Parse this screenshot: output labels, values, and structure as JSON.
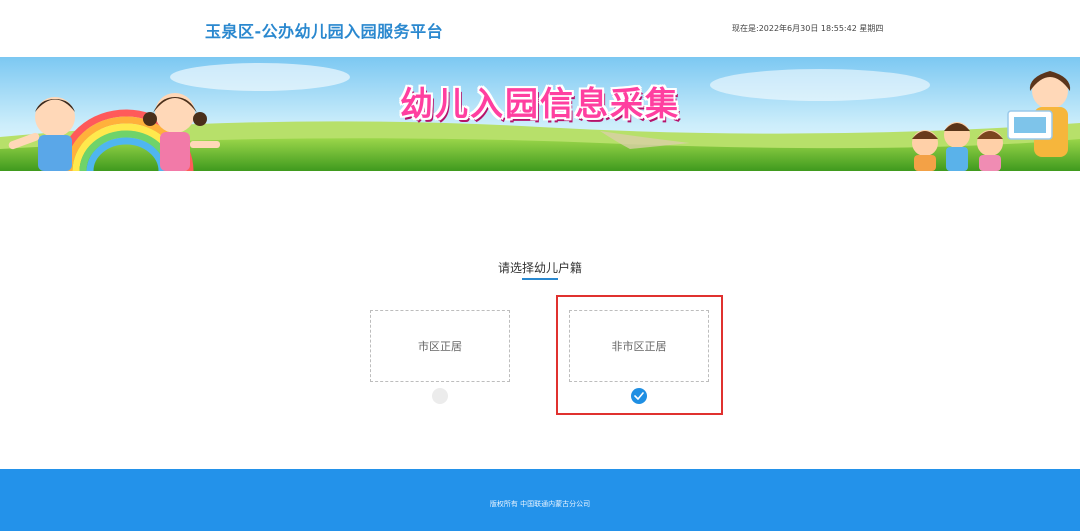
{
  "header": {
    "site_title": "玉泉区-公办幼儿园入园服务平台",
    "datetime": "现在是:2022年6月30日 18:55:42 星期四"
  },
  "banner": {
    "title": "幼儿入园信息采集"
  },
  "main": {
    "prompt": "请选择幼儿户籍",
    "options": [
      {
        "label": "市区正居",
        "selected": false
      },
      {
        "label": "非市区正居",
        "selected": true
      }
    ]
  },
  "footer": {
    "copyright": "版权所有 中国联通内蒙古分公司"
  },
  "colors": {
    "title_blue": "#2a88cf",
    "accent_blue": "#1f8fe3",
    "footer_blue": "#2392ea",
    "highlight_red": "#e0312f",
    "banner_text_pink": "#ff3fa0"
  },
  "icons": {
    "selected_option": "check-icon"
  }
}
